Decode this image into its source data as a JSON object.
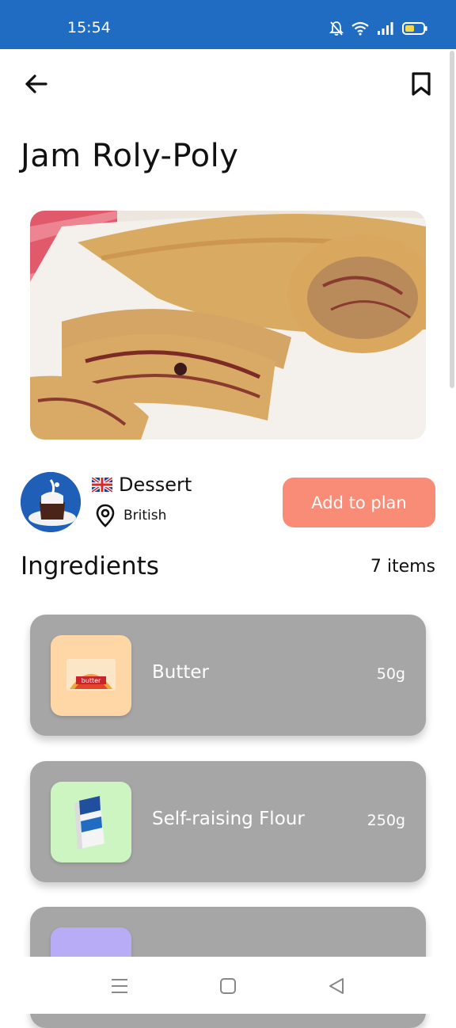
{
  "status": {
    "time": "15:54"
  },
  "header": {
    "title": "Jam Roly-Poly"
  },
  "meal": {
    "category": "Dessert",
    "area": "British",
    "add_label": "Add to plan"
  },
  "ingredients": {
    "title": "Ingredients",
    "count": "7 items",
    "items": [
      {
        "name": "Butter",
        "measure": "50g",
        "tile_color": "#ffd6a6"
      },
      {
        "name": "Self-raising Flour",
        "measure": "250g",
        "tile_color": "#cdf5c2"
      },
      {
        "name": "",
        "measure": "",
        "tile_color": "#b9acf7"
      }
    ]
  },
  "colors": {
    "status_bar": "#1f6cc2",
    "accent": "#f98c77",
    "card": "#a6a6a6"
  }
}
